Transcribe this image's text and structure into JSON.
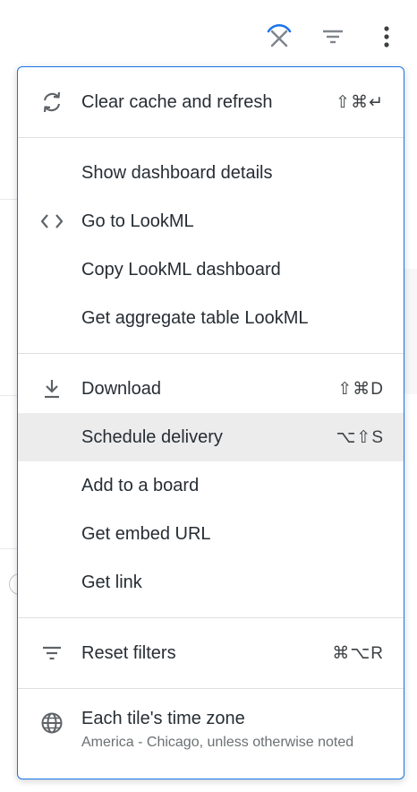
{
  "toolbar": {
    "icons": [
      "loading-cancel-icon",
      "filter-icon",
      "more-vertical-icon"
    ]
  },
  "menu": {
    "sections": [
      {
        "items": [
          {
            "label": "Clear cache and refresh",
            "icon": "refresh-icon",
            "shortcut": "⇧⌘↵"
          }
        ]
      },
      {
        "items": [
          {
            "label": "Show dashboard details",
            "icon": "",
            "shortcut": ""
          },
          {
            "label": "Go to LookML",
            "icon": "code-icon",
            "shortcut": ""
          },
          {
            "label": "Copy LookML dashboard",
            "icon": "",
            "shortcut": ""
          },
          {
            "label": "Get aggregate table LookML",
            "icon": "",
            "shortcut": ""
          }
        ]
      },
      {
        "items": [
          {
            "label": "Download",
            "icon": "download-icon",
            "shortcut": "⇧⌘D"
          },
          {
            "label": "Schedule delivery",
            "icon": "",
            "shortcut": "⌥⇧S",
            "active": true
          },
          {
            "label": "Add to a board",
            "icon": "",
            "shortcut": ""
          },
          {
            "label": "Get embed URL",
            "icon": "",
            "shortcut": ""
          },
          {
            "label": "Get link",
            "icon": "",
            "shortcut": ""
          }
        ]
      },
      {
        "items": [
          {
            "label": "Reset filters",
            "icon": "filter-icon",
            "shortcut": "⌘⌥R"
          }
        ]
      },
      {
        "items": [
          {
            "label": "Each tile's time zone",
            "sublabel": "America - Chicago, unless otherwise noted",
            "icon": "globe-icon",
            "shortcut": ""
          }
        ]
      }
    ]
  },
  "colors": {
    "accent": "#1a73e8",
    "active_bg": "#ececed",
    "divider": "#dedfe0",
    "text": "#262d33",
    "subtext": "#6b7073",
    "icon": "#5f6368"
  }
}
